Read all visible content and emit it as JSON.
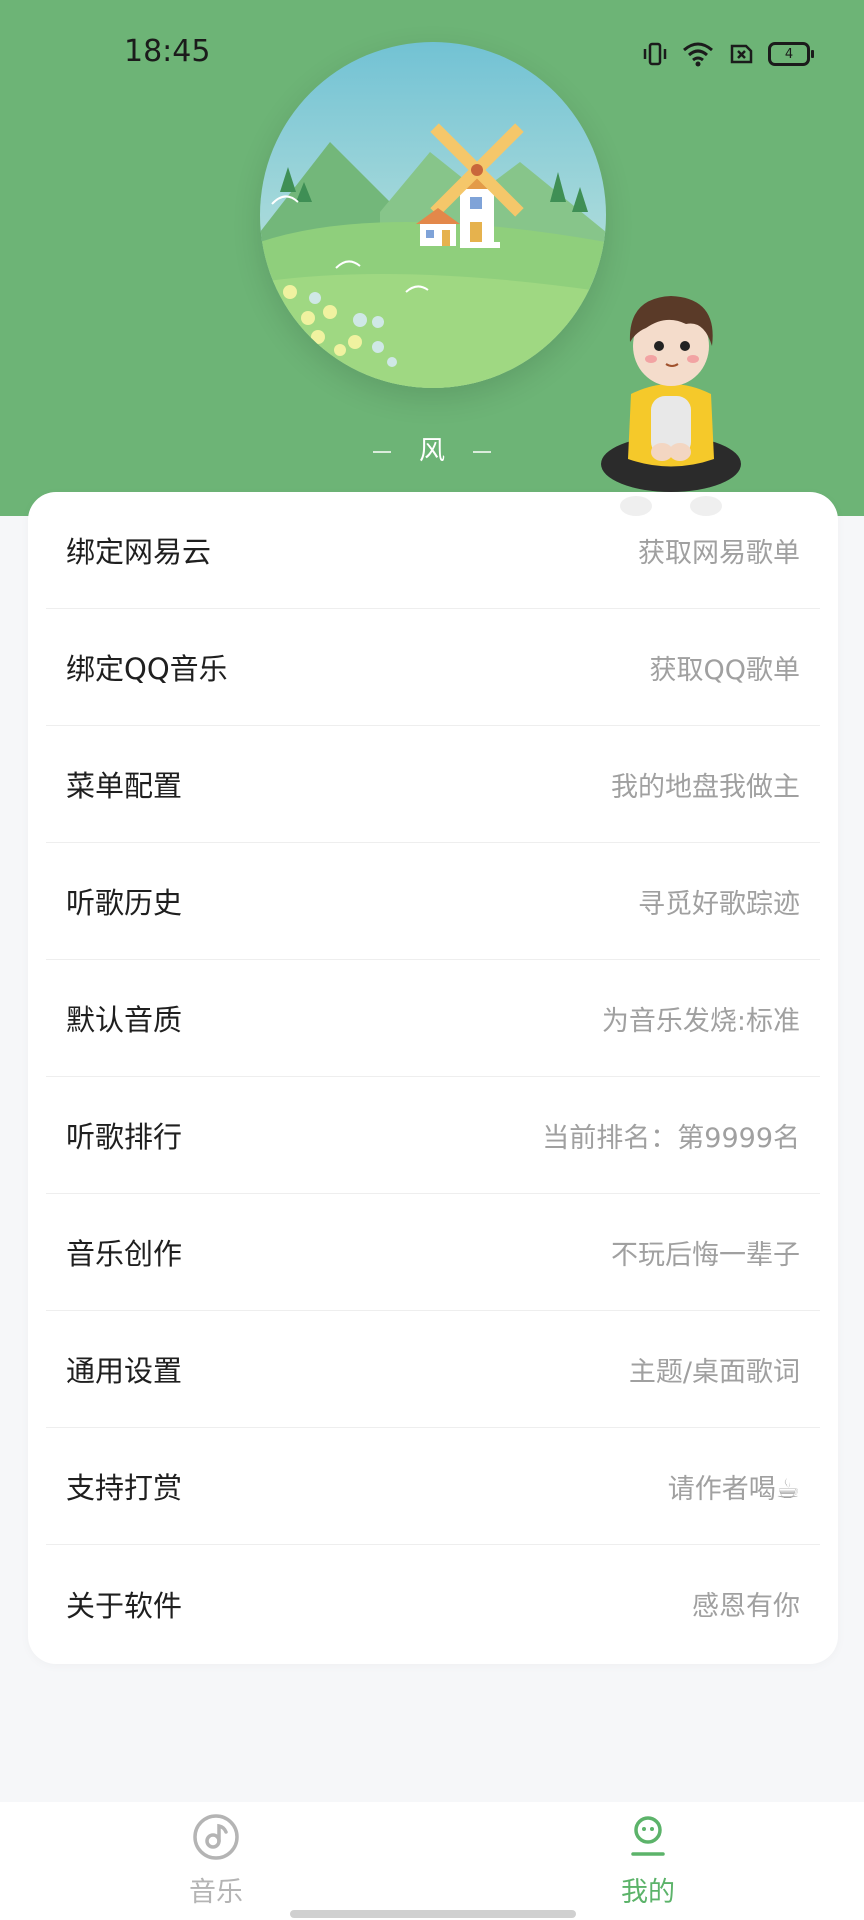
{
  "status_bar": {
    "time": "18:45",
    "battery_level": "4",
    "icons": [
      "vibrate-icon",
      "wifi-icon",
      "sim-off-icon",
      "battery-icon"
    ]
  },
  "header": {
    "song_title": "风",
    "background_color": "#6db476"
  },
  "menu": [
    {
      "label": "绑定网易云",
      "desc": "获取网易歌单"
    },
    {
      "label": "绑定QQ音乐",
      "desc": "获取QQ歌单"
    },
    {
      "label": "菜单配置",
      "desc": "我的地盘我做主"
    },
    {
      "label": "听歌历史",
      "desc": "寻觅好歌踪迹"
    },
    {
      "label": "默认音质",
      "desc": "为音乐发烧:标准"
    },
    {
      "label": "听歌排行",
      "desc": "当前排名：第9999名"
    },
    {
      "label": "音乐创作",
      "desc": "不玩后悔一辈子"
    },
    {
      "label": "通用设置",
      "desc": "主题/桌面歌词"
    },
    {
      "label": "支持打赏",
      "desc": "请作者喝☕"
    },
    {
      "label": "关于软件",
      "desc": "感恩有你"
    }
  ],
  "bottom_nav": {
    "items": [
      {
        "label": "音乐",
        "icon": "music-disc-icon",
        "active": false
      },
      {
        "label": "我的",
        "icon": "profile-icon",
        "active": true
      }
    ],
    "active_color": "#5cb36a",
    "inactive_color": "#b4b4b4"
  }
}
